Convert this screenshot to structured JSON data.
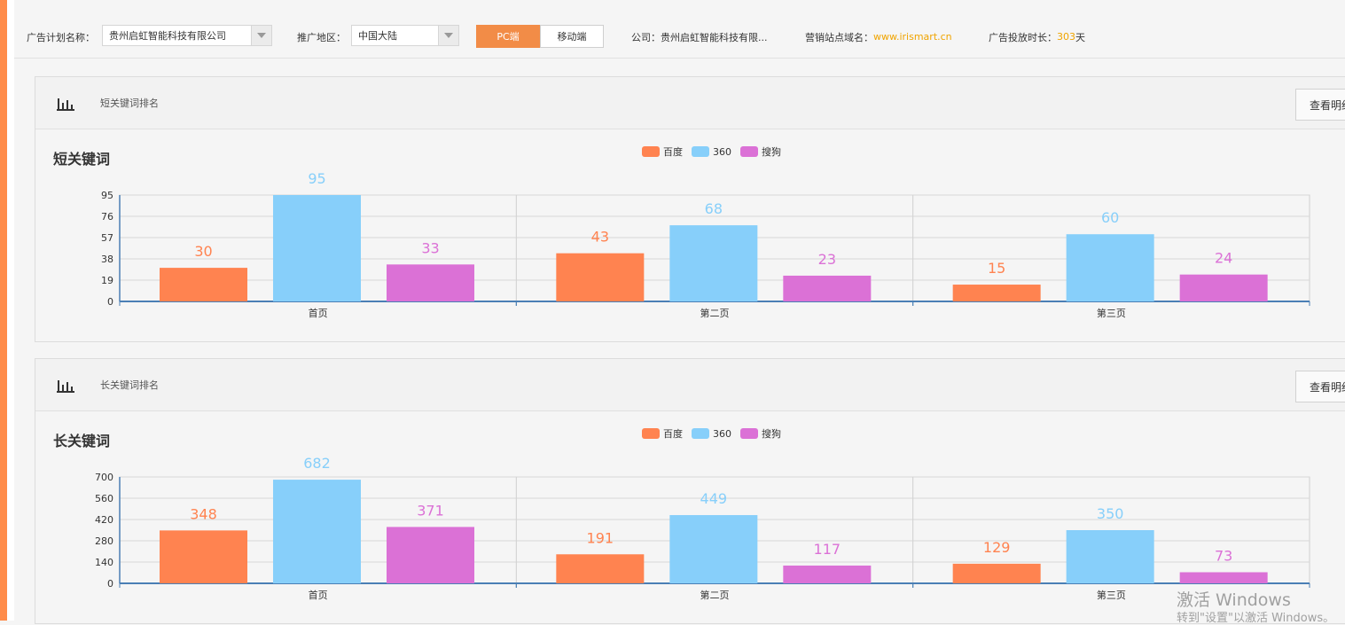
{
  "filters": {
    "plan_label": "广告计划名称：",
    "plan_value": "贵州启虹智能科技有限公司",
    "region_label": "推广地区：",
    "region_value": "中国大陆",
    "platform_pc": "PC端",
    "platform_mobile": "移动端",
    "company_label": "公司：",
    "company_value": "贵州启虹智能科技有限...",
    "site_label": "营销站点域名：",
    "site_value": "www.irismart.cn",
    "duration_label": "广告投放时长：",
    "duration_value": "303",
    "duration_unit": "天"
  },
  "colors": {
    "baidu": "#ff8350",
    "s360": "#87cffa",
    "sogou": "#db71d6",
    "axis": "#4a7fb5",
    "accent": "#f28c47"
  },
  "panels": [
    {
      "title": "短关键词排名",
      "detail_label": "查看明细",
      "heading": "短关键词"
    },
    {
      "title": "长关键词排名",
      "detail_label": "查看明细",
      "heading": "长关键词"
    }
  ],
  "legend": [
    "百度",
    "360",
    "搜狗"
  ],
  "chart_data": [
    {
      "type": "bar",
      "categories": [
        "首页",
        "第二页",
        "第三页"
      ],
      "series": [
        {
          "name": "百度",
          "values": [
            30,
            43,
            15
          ]
        },
        {
          "name": "360",
          "values": [
            95,
            68,
            60
          ]
        },
        {
          "name": "搜狗",
          "values": [
            33,
            23,
            24
          ]
        }
      ],
      "yticks": [
        0,
        19,
        38,
        57,
        76,
        95
      ],
      "ylim": [
        0,
        95
      ],
      "legend_position": "top-center",
      "grid": true
    },
    {
      "type": "bar",
      "categories": [
        "首页",
        "第二页",
        "第三页"
      ],
      "series": [
        {
          "name": "百度",
          "values": [
            348,
            191,
            129
          ]
        },
        {
          "name": "360",
          "values": [
            682,
            449,
            350
          ]
        },
        {
          "name": "搜狗",
          "values": [
            371,
            117,
            73
          ]
        }
      ],
      "yticks": [
        0,
        140,
        280,
        420,
        560,
        700
      ],
      "ylim": [
        0,
        700
      ],
      "legend_position": "top-center",
      "grid": true
    }
  ],
  "watermark": {
    "line1": "激活 Windows",
    "line2": "转到\"设置\"以激活 Windows。"
  }
}
